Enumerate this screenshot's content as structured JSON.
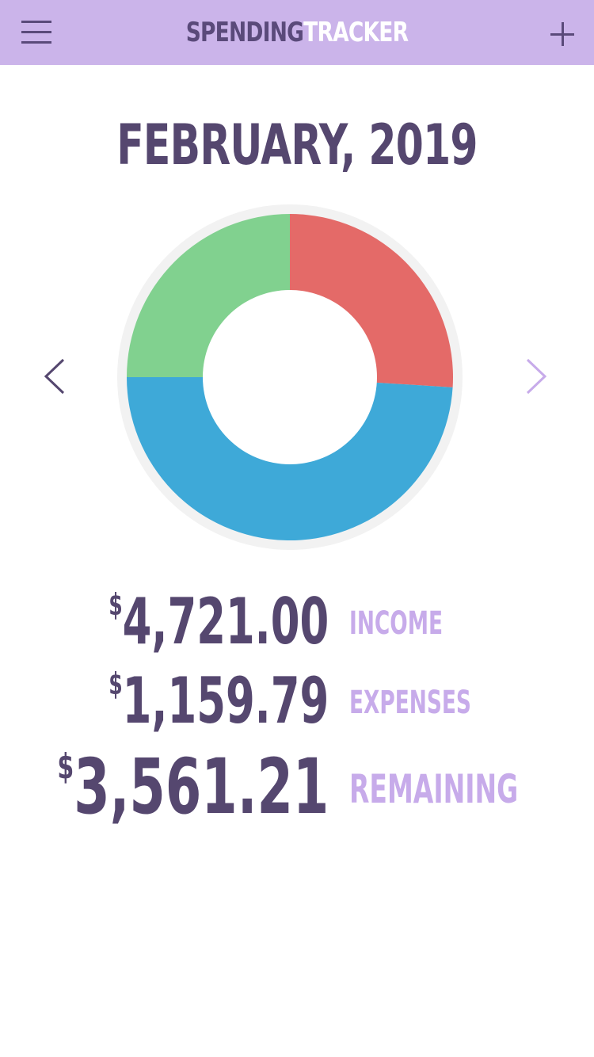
{
  "header": {
    "brand_part1": "SPENDING",
    "brand_part2": "TRACKER",
    "menu_icon": "hamburger-menu-icon",
    "add_icon": "plus-icon",
    "background": "#cbb4ea"
  },
  "month_title": "FEBRUARY, 2019",
  "navigation": {
    "prev_icon": "chevron-left-icon",
    "next_icon": "chevron-right-icon",
    "prev_color": "#55476f",
    "next_color": "#c7abea"
  },
  "chart_data": {
    "type": "pie",
    "slices": [
      {
        "value": 0.26,
        "color": "#e46a68"
      },
      {
        "value": 0.49,
        "color": "#3ea9d8"
      },
      {
        "value": 0.25,
        "color": "#81d18f"
      }
    ]
  },
  "summary": {
    "currency_symbol": "$",
    "income": {
      "amount": "4,721.00",
      "label": "INCOME"
    },
    "expenses": {
      "amount": "1,159.79",
      "label": "EXPENSES"
    },
    "remaining": {
      "amount": "3,561.21",
      "label": "REMAINING"
    }
  },
  "colors": {
    "primary_text": "#55476f",
    "label_text": "#c7abea"
  }
}
